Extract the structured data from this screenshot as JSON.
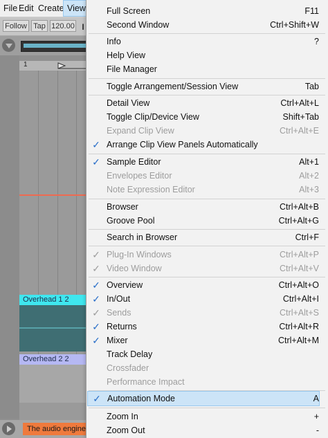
{
  "menubar": {
    "items": [
      {
        "label": "File"
      },
      {
        "label": "Edit"
      },
      {
        "label": "Create"
      },
      {
        "label": "View"
      }
    ]
  },
  "toolbar": {
    "follow_label": "Follow",
    "tap_label": "Tap",
    "tempo_value": "120.00",
    "meter_glyph": "||||"
  },
  "ruler": {
    "bar_number": "1"
  },
  "tracks": {
    "overhead_1_label": "Overhead 1 2",
    "overhead_2_label": "Overhead 2 2",
    "overhead_1_color": "#3fe7ef",
    "overhead_2_color": "#b5b8f3"
  },
  "status": {
    "message": "The audio engine i"
  },
  "colors": {
    "menu_bg": "#f2f2f2",
    "highlight_bg": "#cce4f7",
    "check_color": "#2a6fc9",
    "disabled_text": "#9d9d9d",
    "status_orange": "#ef7a3d"
  },
  "menu": {
    "items": [
      {
        "label": "Full Screen",
        "shortcut": "F11",
        "checked": false,
        "disabled": false
      },
      {
        "label": "Second Window",
        "shortcut": "Ctrl+Shift+W",
        "checked": false,
        "disabled": false
      },
      {
        "label": "Info",
        "shortcut": "?",
        "checked": false,
        "disabled": false
      },
      {
        "label": "Help View",
        "shortcut": "",
        "checked": false,
        "disabled": false
      },
      {
        "label": "File Manager",
        "shortcut": "",
        "checked": false,
        "disabled": false
      },
      {
        "label": "Toggle Arrangement/Session View",
        "shortcut": "Tab",
        "checked": false,
        "disabled": false
      },
      {
        "label": "Detail View",
        "shortcut": "Ctrl+Alt+L",
        "checked": false,
        "disabled": false
      },
      {
        "label": "Toggle Clip/Device View",
        "shortcut": "Shift+Tab",
        "checked": false,
        "disabled": false
      },
      {
        "label": "Expand Clip View",
        "shortcut": "Ctrl+Alt+E",
        "checked": false,
        "disabled": true
      },
      {
        "label": "Arrange Clip View Panels Automatically",
        "shortcut": "",
        "checked": true,
        "disabled": false
      },
      {
        "label": "Sample Editor",
        "shortcut": "Alt+1",
        "checked": true,
        "disabled": false
      },
      {
        "label": "Envelopes Editor",
        "shortcut": "Alt+2",
        "checked": false,
        "disabled": true
      },
      {
        "label": "Note Expression Editor",
        "shortcut": "Alt+3",
        "checked": false,
        "disabled": true
      },
      {
        "label": "Browser",
        "shortcut": "Ctrl+Alt+B",
        "checked": false,
        "disabled": false
      },
      {
        "label": "Groove Pool",
        "shortcut": "Ctrl+Alt+G",
        "checked": false,
        "disabled": false
      },
      {
        "label": "Search in Browser",
        "shortcut": "Ctrl+F",
        "checked": false,
        "disabled": false
      },
      {
        "label": "Plug-In Windows",
        "shortcut": "Ctrl+Alt+P",
        "checked": true,
        "disabled": true
      },
      {
        "label": "Video Window",
        "shortcut": "Ctrl+Alt+V",
        "checked": true,
        "disabled": true
      },
      {
        "label": "Overview",
        "shortcut": "Ctrl+Alt+O",
        "checked": true,
        "disabled": false
      },
      {
        "label": "In/Out",
        "shortcut": "Ctrl+Alt+I",
        "checked": true,
        "disabled": false
      },
      {
        "label": "Sends",
        "shortcut": "Ctrl+Alt+S",
        "checked": true,
        "disabled": true
      },
      {
        "label": "Returns",
        "shortcut": "Ctrl+Alt+R",
        "checked": true,
        "disabled": false
      },
      {
        "label": "Mixer",
        "shortcut": "Ctrl+Alt+M",
        "checked": true,
        "disabled": false
      },
      {
        "label": "Track Delay",
        "shortcut": "",
        "checked": false,
        "disabled": false
      },
      {
        "label": "Crossfader",
        "shortcut": "",
        "checked": false,
        "disabled": true
      },
      {
        "label": "Performance Impact",
        "shortcut": "",
        "checked": false,
        "disabled": true
      },
      {
        "label": "Automation Mode",
        "shortcut": "A",
        "checked": true,
        "disabled": false,
        "highlighted": true
      },
      {
        "label": "Zoom In",
        "shortcut": "+",
        "checked": false,
        "disabled": false
      },
      {
        "label": "Zoom Out",
        "shortcut": "-",
        "checked": false,
        "disabled": false
      }
    ]
  }
}
